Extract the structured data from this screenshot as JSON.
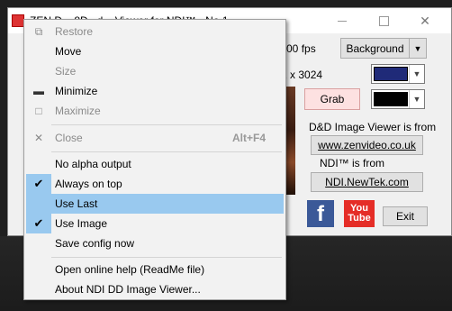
{
  "window": {
    "title": "ZEN D... 8D...d... Viewer for NDI™ - No.1"
  },
  "controls": {
    "fps_text": "0.00 fps",
    "background_label": "Background",
    "resolution_text": "2 x 3024",
    "grab_label": "Grab",
    "info_label_1": "D&D Image Viewer is from",
    "link_1": "www.zenvideo.co.uk",
    "info_label_2": "NDI™ is from",
    "link_2": "NDI.NewTek.com",
    "facebook_glyph": "f",
    "youtube_line1": "You",
    "youtube_line2": "Tube",
    "exit_label": "Exit",
    "color_1": "#1f2a78",
    "color_2": "#000000"
  },
  "menu": {
    "items": [
      {
        "label": "Restore",
        "icon": "restore-icon",
        "glyph": "⧉",
        "enabled": false
      },
      {
        "label": "Move",
        "enabled": true
      },
      {
        "label": "Size",
        "enabled": false
      },
      {
        "label": "Minimize",
        "icon": "minimize-icon",
        "glyph": "▬",
        "enabled": true
      },
      {
        "label": "Maximize",
        "icon": "maximize-icon",
        "glyph": "□",
        "enabled": false
      },
      {
        "label": "Close",
        "icon": "close-icon",
        "glyph": "✕",
        "shortcut": "Alt+F4",
        "enabled": false
      },
      {
        "label": "No alpha output",
        "checked": false
      },
      {
        "label": "Always on top",
        "checked": true
      },
      {
        "label": "Use Last",
        "checked": false,
        "highlighted": true
      },
      {
        "label": "Use Image",
        "checked": true
      },
      {
        "label": "Save config now",
        "checked": false
      },
      {
        "label": "Open online help (ReadMe file)"
      },
      {
        "label": "About NDI DD Image Viewer..."
      }
    ],
    "check_glyph": "✔"
  }
}
